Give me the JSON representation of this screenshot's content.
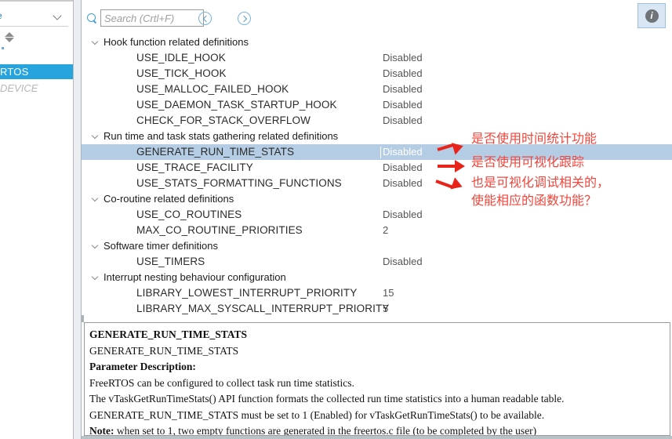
{
  "sidebar": {
    "combo_value": "e",
    "combo_icon": "chevron-down-icon",
    "scroll_icon": "scroll-up-down-icon",
    "selected_item": "RTOS",
    "dimmed_item": "DEVICE"
  },
  "toolbar": {
    "search_placeholder": "Search (Crtl+F)",
    "search_value": "",
    "search_icon": "search-icon",
    "back_icon": "chevron-left-circle-icon",
    "forward_icon": "chevron-right-circle-icon",
    "info_icon": "info-icon",
    "info_label": "i"
  },
  "tree": {
    "rows": [
      {
        "type": "group",
        "label": "Hook function related definitions",
        "value": ""
      },
      {
        "type": "param",
        "label": "USE_IDLE_HOOK",
        "value": "Disabled"
      },
      {
        "type": "param",
        "label": "USE_TICK_HOOK",
        "value": "Disabled"
      },
      {
        "type": "param",
        "label": "USE_MALLOC_FAILED_HOOK",
        "value": "Disabled"
      },
      {
        "type": "param",
        "label": "USE_DAEMON_TASK_STARTUP_HOOK",
        "value": "Disabled"
      },
      {
        "type": "param",
        "label": "CHECK_FOR_STACK_OVERFLOW",
        "value": "Disabled"
      },
      {
        "type": "group",
        "label": "Run time and task stats gathering related definitions",
        "value": ""
      },
      {
        "type": "param",
        "label": "GENERATE_RUN_TIME_STATS",
        "value": "Disabled",
        "selected": true
      },
      {
        "type": "param",
        "label": "USE_TRACE_FACILITY",
        "value": "Disabled"
      },
      {
        "type": "param",
        "label": "USE_STATS_FORMATTING_FUNCTIONS",
        "value": "Disabled"
      },
      {
        "type": "group",
        "label": "Co-routine related definitions",
        "value": ""
      },
      {
        "type": "param",
        "label": "USE_CO_ROUTINES",
        "value": "Disabled"
      },
      {
        "type": "param",
        "label": "MAX_CO_ROUTINE_PRIORITIES",
        "value": "2"
      },
      {
        "type": "group",
        "label": "Software timer definitions",
        "value": ""
      },
      {
        "type": "param",
        "label": "USE_TIMERS",
        "value": "Disabled"
      },
      {
        "type": "group",
        "label": "Interrupt nesting behaviour configuration",
        "value": ""
      },
      {
        "type": "param",
        "label": "LIBRARY_LOWEST_INTERRUPT_PRIORITY",
        "value": "15"
      },
      {
        "type": "param",
        "label": "LIBRARY_MAX_SYSCALL_INTERRUPT_PRIORITY",
        "value": "5"
      }
    ]
  },
  "annotations": {
    "color": "#f0463c",
    "items": [
      {
        "text": "是否使用时间统计功能",
        "arrow_icon": "red-arrow-icon"
      },
      {
        "text": "是否使用可视化跟踪",
        "arrow_icon": "red-arrow-icon"
      },
      {
        "text": "也是可视化调试相关的，",
        "arrow_icon": "red-arrow-icon"
      },
      {
        "text": "使能相应的函数功能？",
        "arrow_icon": ""
      }
    ]
  },
  "description": {
    "title": "GENERATE_RUN_TIME_STATS",
    "subtitle": "GENERATE_RUN_TIME_STATS",
    "section_heading": "Parameter Description:",
    "body": [
      "FreeRTOS can be configured to collect task run time statistics.",
      "The vTaskGetRunTimeStats() API function formats the collected run time statistics into a human readable table.",
      "GENERATE_RUN_TIME_STATS must be set to 1 (Enabled) for vTaskGetRunTimeStats() to be available."
    ],
    "note_label": "Note:",
    "note_text": " when set to 1, two empty functions are generated in the freertos.c file (to be completed by the user)"
  }
}
